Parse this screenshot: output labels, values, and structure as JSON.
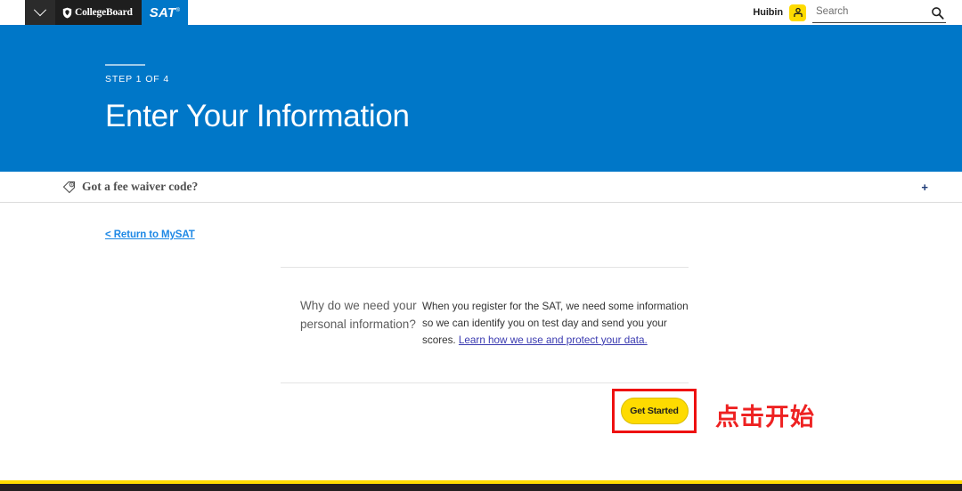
{
  "topbar": {
    "nav_toggle_icon": "chevron-down-icon",
    "brand_collegeboard": "CollegeBoard",
    "brand_acorn_icon": "acorn-shield-icon",
    "brand_sat": "SAT",
    "brand_sat_trademark": "®",
    "user_name": "Huibin",
    "avatar_icon": "user-avatar-icon",
    "search_placeholder": "Search",
    "search_value": "",
    "search_icon": "search-icon"
  },
  "hero": {
    "step_label": "STEP 1 OF 4",
    "title": "Enter Your Information",
    "background_color": "#0077c8"
  },
  "fee_waiver": {
    "icon": "price-tag-icon",
    "label": "Got a fee waiver code?",
    "expand_symbol": "+"
  },
  "body": {
    "return_link": "< Return to MySAT",
    "info": {
      "question": "Why do we need your personal information?",
      "answer": "When you register for the SAT, we need some information so we can identify you on test day and send you your scores.",
      "link_text": "Learn how we use and protect your data."
    },
    "get_started_button": "Get Started"
  },
  "annotation": {
    "text": "点击开始",
    "color": "#ee2222",
    "highlight_box_color": "#ee1111"
  },
  "footer": {
    "accent_color": "#fedb00",
    "band_color": "#231f20"
  }
}
